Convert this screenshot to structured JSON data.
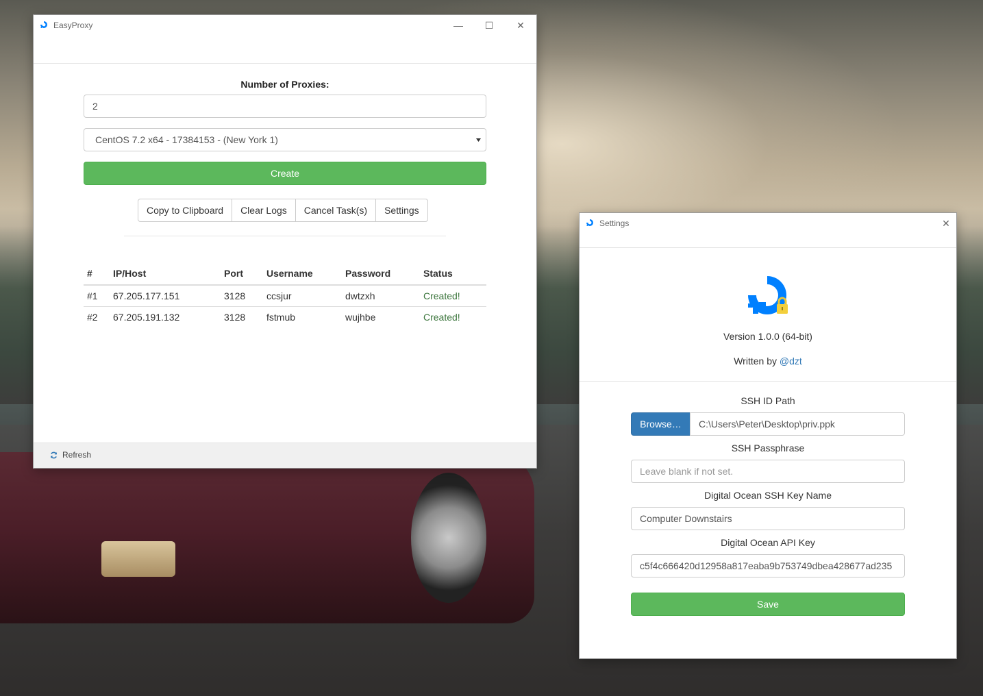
{
  "main_window": {
    "title": "EasyProxy",
    "controls": {
      "minimize": "—",
      "maximize": "☐",
      "close": "✕"
    },
    "num_proxies_label": "Number of Proxies:",
    "num_proxies_value": "2",
    "image_select_value": "CentOS 7.2 x64 - 17384153 - (New York 1)",
    "create_label": "Create",
    "actions": [
      "Copy to Clipboard",
      "Clear Logs",
      "Cancel Task(s)",
      "Settings"
    ],
    "table": {
      "headers": [
        "#",
        "IP/Host",
        "Port",
        "Username",
        "Password",
        "Status"
      ],
      "rows": [
        [
          "#1",
          "67.205.177.151",
          "3128",
          "ccsjur",
          "dwtzxh",
          "Created!"
        ],
        [
          "#2",
          "67.205.191.132",
          "3128",
          "fstmub",
          "wujhbe",
          "Created!"
        ]
      ]
    },
    "footer_refresh": "Refresh"
  },
  "settings_window": {
    "title": "Settings",
    "close": "✕",
    "version": "Version 1.0.0 (64-bit)",
    "written_by_prefix": "Written by ",
    "author_link": "@dzt",
    "ssh_id_path_label": "SSH ID Path",
    "browse_label": "Browse…",
    "ssh_id_path_value": "C:\\Users\\Peter\\Desktop\\priv.ppk",
    "ssh_passphrase_label": "SSH Passphrase",
    "ssh_passphrase_placeholder": "Leave blank if not set.",
    "key_name_label": "Digital Ocean SSH Key Name",
    "key_name_value": "Computer Downstairs",
    "api_key_label": "Digital Ocean API Key",
    "api_key_value": "c5f4c666420d12958a817eaba9b753749dbea428677ad235",
    "save_label": "Save"
  },
  "colors": {
    "success_green": "#5cb85c",
    "primary_blue": "#337ab7",
    "status_text_green": "#3c763d",
    "logo_blue": "#0080ff"
  },
  "icons": {
    "app": "digitalocean-logo-icon",
    "refresh": "refresh-icon",
    "select": "caret-down-icon",
    "lock": "lock-icon"
  }
}
